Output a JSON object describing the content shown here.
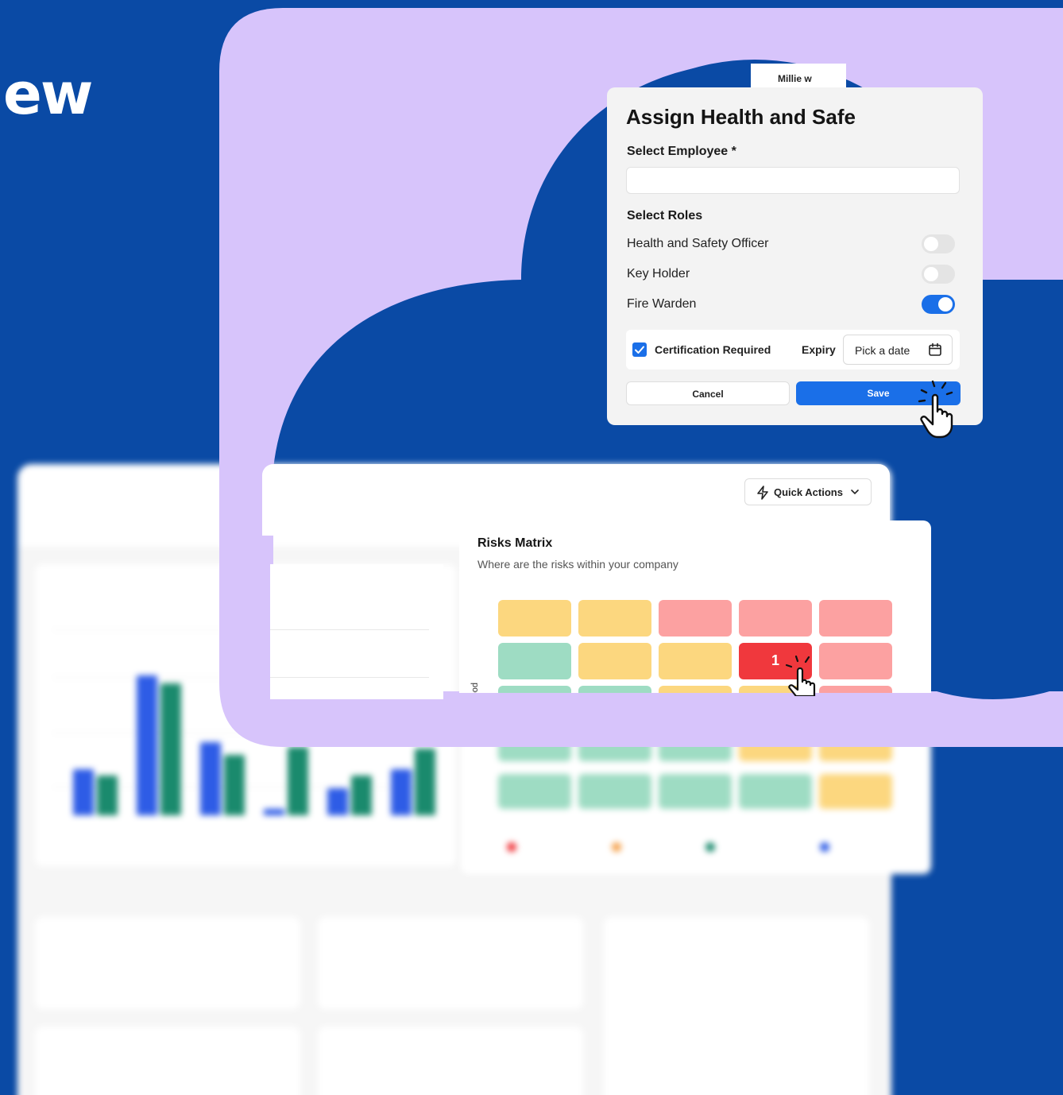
{
  "hero": {
    "title": "ew"
  },
  "colors": {
    "background": "#0a4aa5",
    "lavender": "#d7c4fb",
    "primary": "#1a6fe8",
    "amber": "#fcd77f",
    "salmon": "#fca1a1",
    "mint": "#9edcc3",
    "extreme": "#f0383d"
  },
  "modal": {
    "title": "Assign Health and Safe",
    "peek_name": "Millie w",
    "employee_label": "Select Employee *",
    "roles_label": "Select Roles",
    "roles": [
      {
        "label": "Health and Safety Officer",
        "enabled": false
      },
      {
        "label": "Key Holder",
        "enabled": false
      },
      {
        "label": "Fire Warden",
        "enabled": true
      }
    ],
    "certification_label": "Certification Required",
    "certification_checked": true,
    "expiry_label": "Expiry",
    "date_placeholder": "Pick a date",
    "cancel_label": "Cancel",
    "save_label": "Save"
  },
  "quick_actions": {
    "label": "Quick Actions"
  },
  "risks_matrix": {
    "title": "Risks Matrix",
    "subtitle": "Where are the risks within your company",
    "axis_label": "pod",
    "rows": [
      [
        "amber",
        "amber",
        "salmon",
        "salmon",
        "salmon"
      ],
      [
        "mint",
        "amber",
        "amber",
        "extreme",
        "salmon"
      ],
      [
        "mint",
        "mint",
        "amber",
        "amber",
        "salmon"
      ]
    ],
    "highlighted_count": "1"
  },
  "icons": [
    "bolt-icon",
    "chevron-down-icon",
    "calendar-icon",
    "check-icon",
    "pointer-hand-icon"
  ]
}
